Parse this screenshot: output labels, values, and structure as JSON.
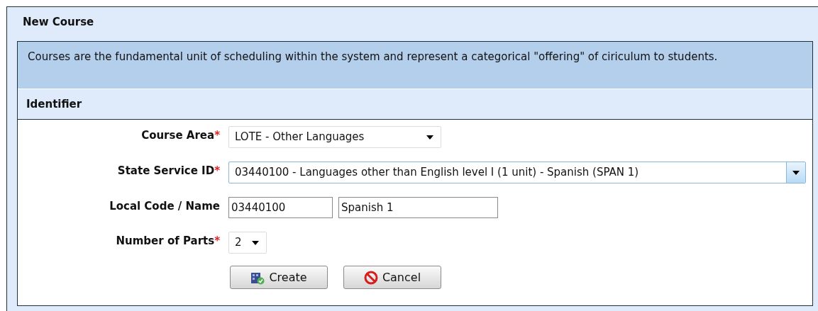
{
  "panel": {
    "title": "New Course"
  },
  "description": "Courses are the fundamental unit of scheduling within the system and represent a categorical \"offering\" of ciriculum to students.",
  "section": {
    "title": "Identifier"
  },
  "required_marker": "*",
  "fields": [
    {
      "kind": "select",
      "label": "Course Area",
      "required": true,
      "value": "LOTE - Other Languages",
      "focused": false
    },
    {
      "kind": "select",
      "label": "State Service ID",
      "required": true,
      "value": "03440100 - Languages other than English level I (1 unit) - Spanish (SPAN 1)",
      "focused": true
    },
    {
      "kind": "text_pair",
      "label": "Local Code / Name",
      "required": false,
      "values": [
        "03440100",
        "Spanish 1"
      ]
    },
    {
      "kind": "select",
      "label": "Number of Parts",
      "required": true,
      "value": "2",
      "focused": false
    }
  ],
  "buttons": [
    {
      "kind": "create",
      "label": "Create"
    },
    {
      "kind": "cancel",
      "label": "Cancel"
    }
  ]
}
